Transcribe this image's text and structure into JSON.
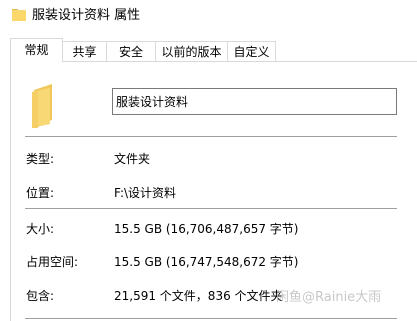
{
  "window": {
    "title": "服装设计资料 属性"
  },
  "tabs": [
    {
      "label": "常规",
      "active": true
    },
    {
      "label": "共享",
      "active": false
    },
    {
      "label": "安全",
      "active": false
    },
    {
      "label": "以前的版本",
      "active": false
    },
    {
      "label": "自定义",
      "active": false
    }
  ],
  "general": {
    "name_value": "服装设计资料",
    "type": {
      "label": "类型:",
      "value": "文件夹"
    },
    "location": {
      "label": "位置:",
      "value": "F:\\设计资料"
    },
    "size": {
      "label": "大小:",
      "value": "15.5 GB (16,706,487,657 字节)"
    },
    "size_on_disk": {
      "label": "占用空间:",
      "value": "15.5 GB (16,747,548,672 字节)"
    },
    "contains": {
      "label": "包含:",
      "value": "21,591 个文件，836 个文件夹"
    }
  },
  "watermark": "闲鱼@Rainie大雨",
  "colors": {
    "folder_yellow": "#f8d775",
    "folder_shadow": "#e0b84e",
    "border": "#d9d9d9",
    "separator": "#a0a0a0"
  },
  "icons": {
    "title": "folder-icon",
    "main": "folder-icon"
  }
}
